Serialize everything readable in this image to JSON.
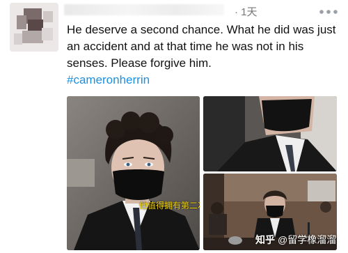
{
  "post": {
    "timestamp": "· 1天",
    "text": "He deserve a second chance. What he did was just an accident and at that time he was not in his senses. Please forgive him.",
    "hashtag": "#cameronherrin"
  },
  "media": {
    "caption": "他值得拥有第二次机会。那只是个意外，请原谅他。"
  },
  "watermark": {
    "logo": "知乎",
    "handle": "@留学橡溜溜"
  },
  "colors": {
    "hashtag": "#1b8fe0",
    "caption": "#f5d400",
    "timestamp": "#777777"
  },
  "icons": {
    "more": "more-dots-icon"
  }
}
